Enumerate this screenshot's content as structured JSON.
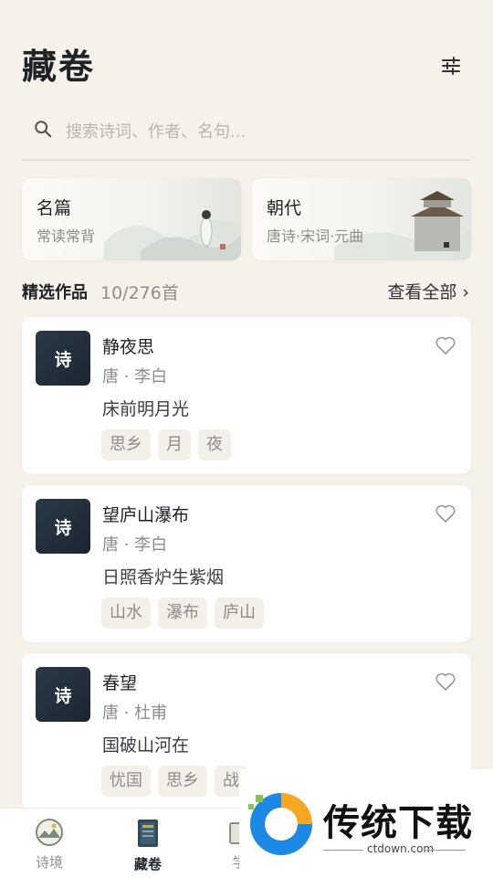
{
  "header": {
    "title": "藏卷"
  },
  "search": {
    "placeholder": "搜索诗词、作者、名句..."
  },
  "categories": [
    {
      "name": "名篇",
      "sub": "常读常背"
    },
    {
      "name": "朝代",
      "sub": "唐诗·宋词·元曲"
    }
  ],
  "section": {
    "title": "精选作品",
    "count": "10/276首",
    "view_all": "查看全部 ›"
  },
  "poems": [
    {
      "badge": "诗",
      "title": "静夜思",
      "meta": "唐 · 李白",
      "line": "床前明月光",
      "tags": [
        "思乡",
        "月",
        "夜"
      ]
    },
    {
      "badge": "诗",
      "title": "望庐山瀑布",
      "meta": "唐 · 李白",
      "line": "日照香炉生紫烟",
      "tags": [
        "山水",
        "瀑布",
        "庐山"
      ]
    },
    {
      "badge": "诗",
      "title": "春望",
      "meta": "唐 · 杜甫",
      "line": "国破山河在",
      "tags": [
        "忧国",
        "思乡",
        "战"
      ]
    }
  ],
  "nav": [
    {
      "label": "诗境",
      "icon": "landscape-icon"
    },
    {
      "label": "藏卷",
      "icon": "book-icon"
    },
    {
      "label": "学",
      "icon": "study-icon"
    }
  ],
  "watermark": {
    "text": "传统下载",
    "url": "ctdown.com"
  },
  "colors": {
    "background": "#f6f2ea",
    "badge": "#1f2c38",
    "tag_bg": "#f3f0ea",
    "watermark_blue": "#1e88e5",
    "watermark_orange": "#f5a623"
  }
}
